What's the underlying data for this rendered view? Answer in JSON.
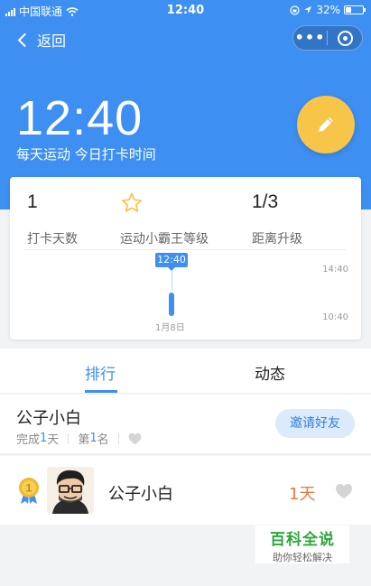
{
  "status_bar": {
    "carrier": "中国联通",
    "time": "12:40",
    "battery": "32%",
    "battery_level": 0.32
  },
  "nav": {
    "back_label": "返回",
    "more_label": "•••"
  },
  "hero": {
    "time": "12:40",
    "subtitle": "每天运动 今日打卡时间"
  },
  "stats": [
    {
      "value": "1",
      "label": "打卡天数"
    },
    {
      "value": "",
      "label": "运动小霸王等级"
    },
    {
      "value": "1/3",
      "label": "距离升级"
    }
  ],
  "timeline": {
    "badge_time": "12:40",
    "date": "1月8日",
    "tick_top": "14:40",
    "tick_bottom": "10:40"
  },
  "tabs": [
    {
      "label": "排行",
      "active": true
    },
    {
      "label": "动态",
      "active": false
    }
  ],
  "me": {
    "name": "公子小白",
    "done_prefix": "完成",
    "done_count": "1",
    "done_suffix": "天",
    "rank_prefix": "第",
    "rank_value": "1",
    "rank_suffix": "名",
    "invite_label": "邀请好友"
  },
  "ranking": [
    {
      "rank": "1",
      "name": "公子小白",
      "days": "1天"
    }
  ],
  "watermark": {
    "title": "百科全说",
    "subtitle": "助你轻松解决"
  },
  "colors": {
    "primary": "#3d8ff2",
    "accent": "#f7c548",
    "days": "#e67a3b"
  }
}
